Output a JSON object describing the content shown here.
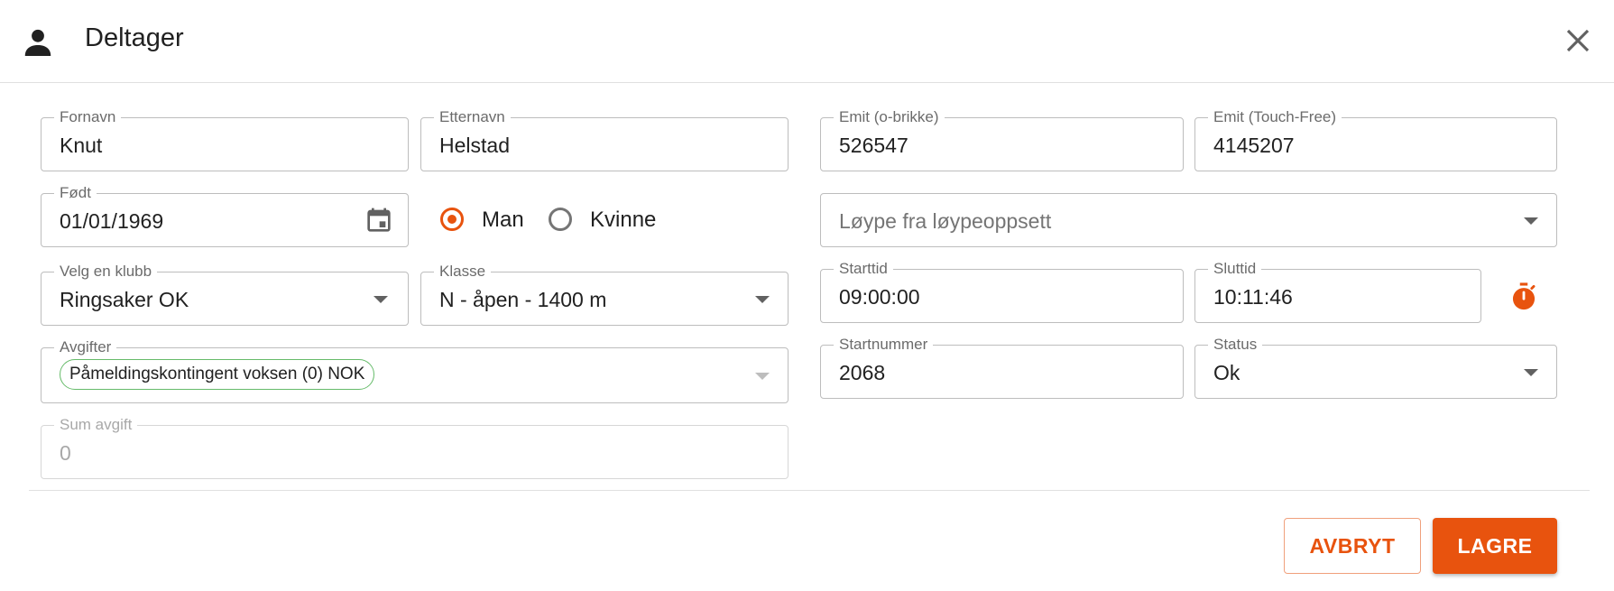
{
  "dialog": {
    "title": "Deltager",
    "icon": "person-icon",
    "close_icon": "close-icon"
  },
  "form": {
    "first_name": {
      "label": "Fornavn",
      "value": "Knut"
    },
    "last_name": {
      "label": "Etternavn",
      "value": "Helstad"
    },
    "emit_card": {
      "label": "Emit (o-brikke)",
      "value": "526547"
    },
    "emit_touch": {
      "label": "Emit (Touch-Free)",
      "value": "4145207"
    },
    "born": {
      "label": "Født",
      "value": "01/01/1969",
      "icon": "calendar-icon"
    },
    "gender": {
      "selected": "Man",
      "options": [
        {
          "label": "Man"
        },
        {
          "label": "Kvinne"
        }
      ]
    },
    "course": {
      "placeholder": "Løype fra løypeoppsett"
    },
    "club": {
      "label": "Velg en klubb",
      "value": "Ringsaker OK"
    },
    "class": {
      "label": "Klasse",
      "value": "N - åpen - 1400 m"
    },
    "start_time": {
      "label": "Starttid",
      "value": "09:00:00"
    },
    "finish_time": {
      "label": "Sluttid",
      "value": "10:11:46",
      "icon": "stopwatch-icon"
    },
    "fees": {
      "label": "Avgifter",
      "chips": [
        "Påmeldingskontingent voksen (0) NOK"
      ]
    },
    "start_number": {
      "label": "Startnummer",
      "value": "2068"
    },
    "status": {
      "label": "Status",
      "value": "Ok"
    },
    "fee_sum": {
      "label": "Sum avgift",
      "value": "0"
    }
  },
  "actions": {
    "cancel_label": "AVBRYT",
    "save_label": "LAGRE"
  },
  "colors": {
    "accent": "#e8530e",
    "chip_border": "#66bb6a",
    "border": "#bdbdbd"
  }
}
